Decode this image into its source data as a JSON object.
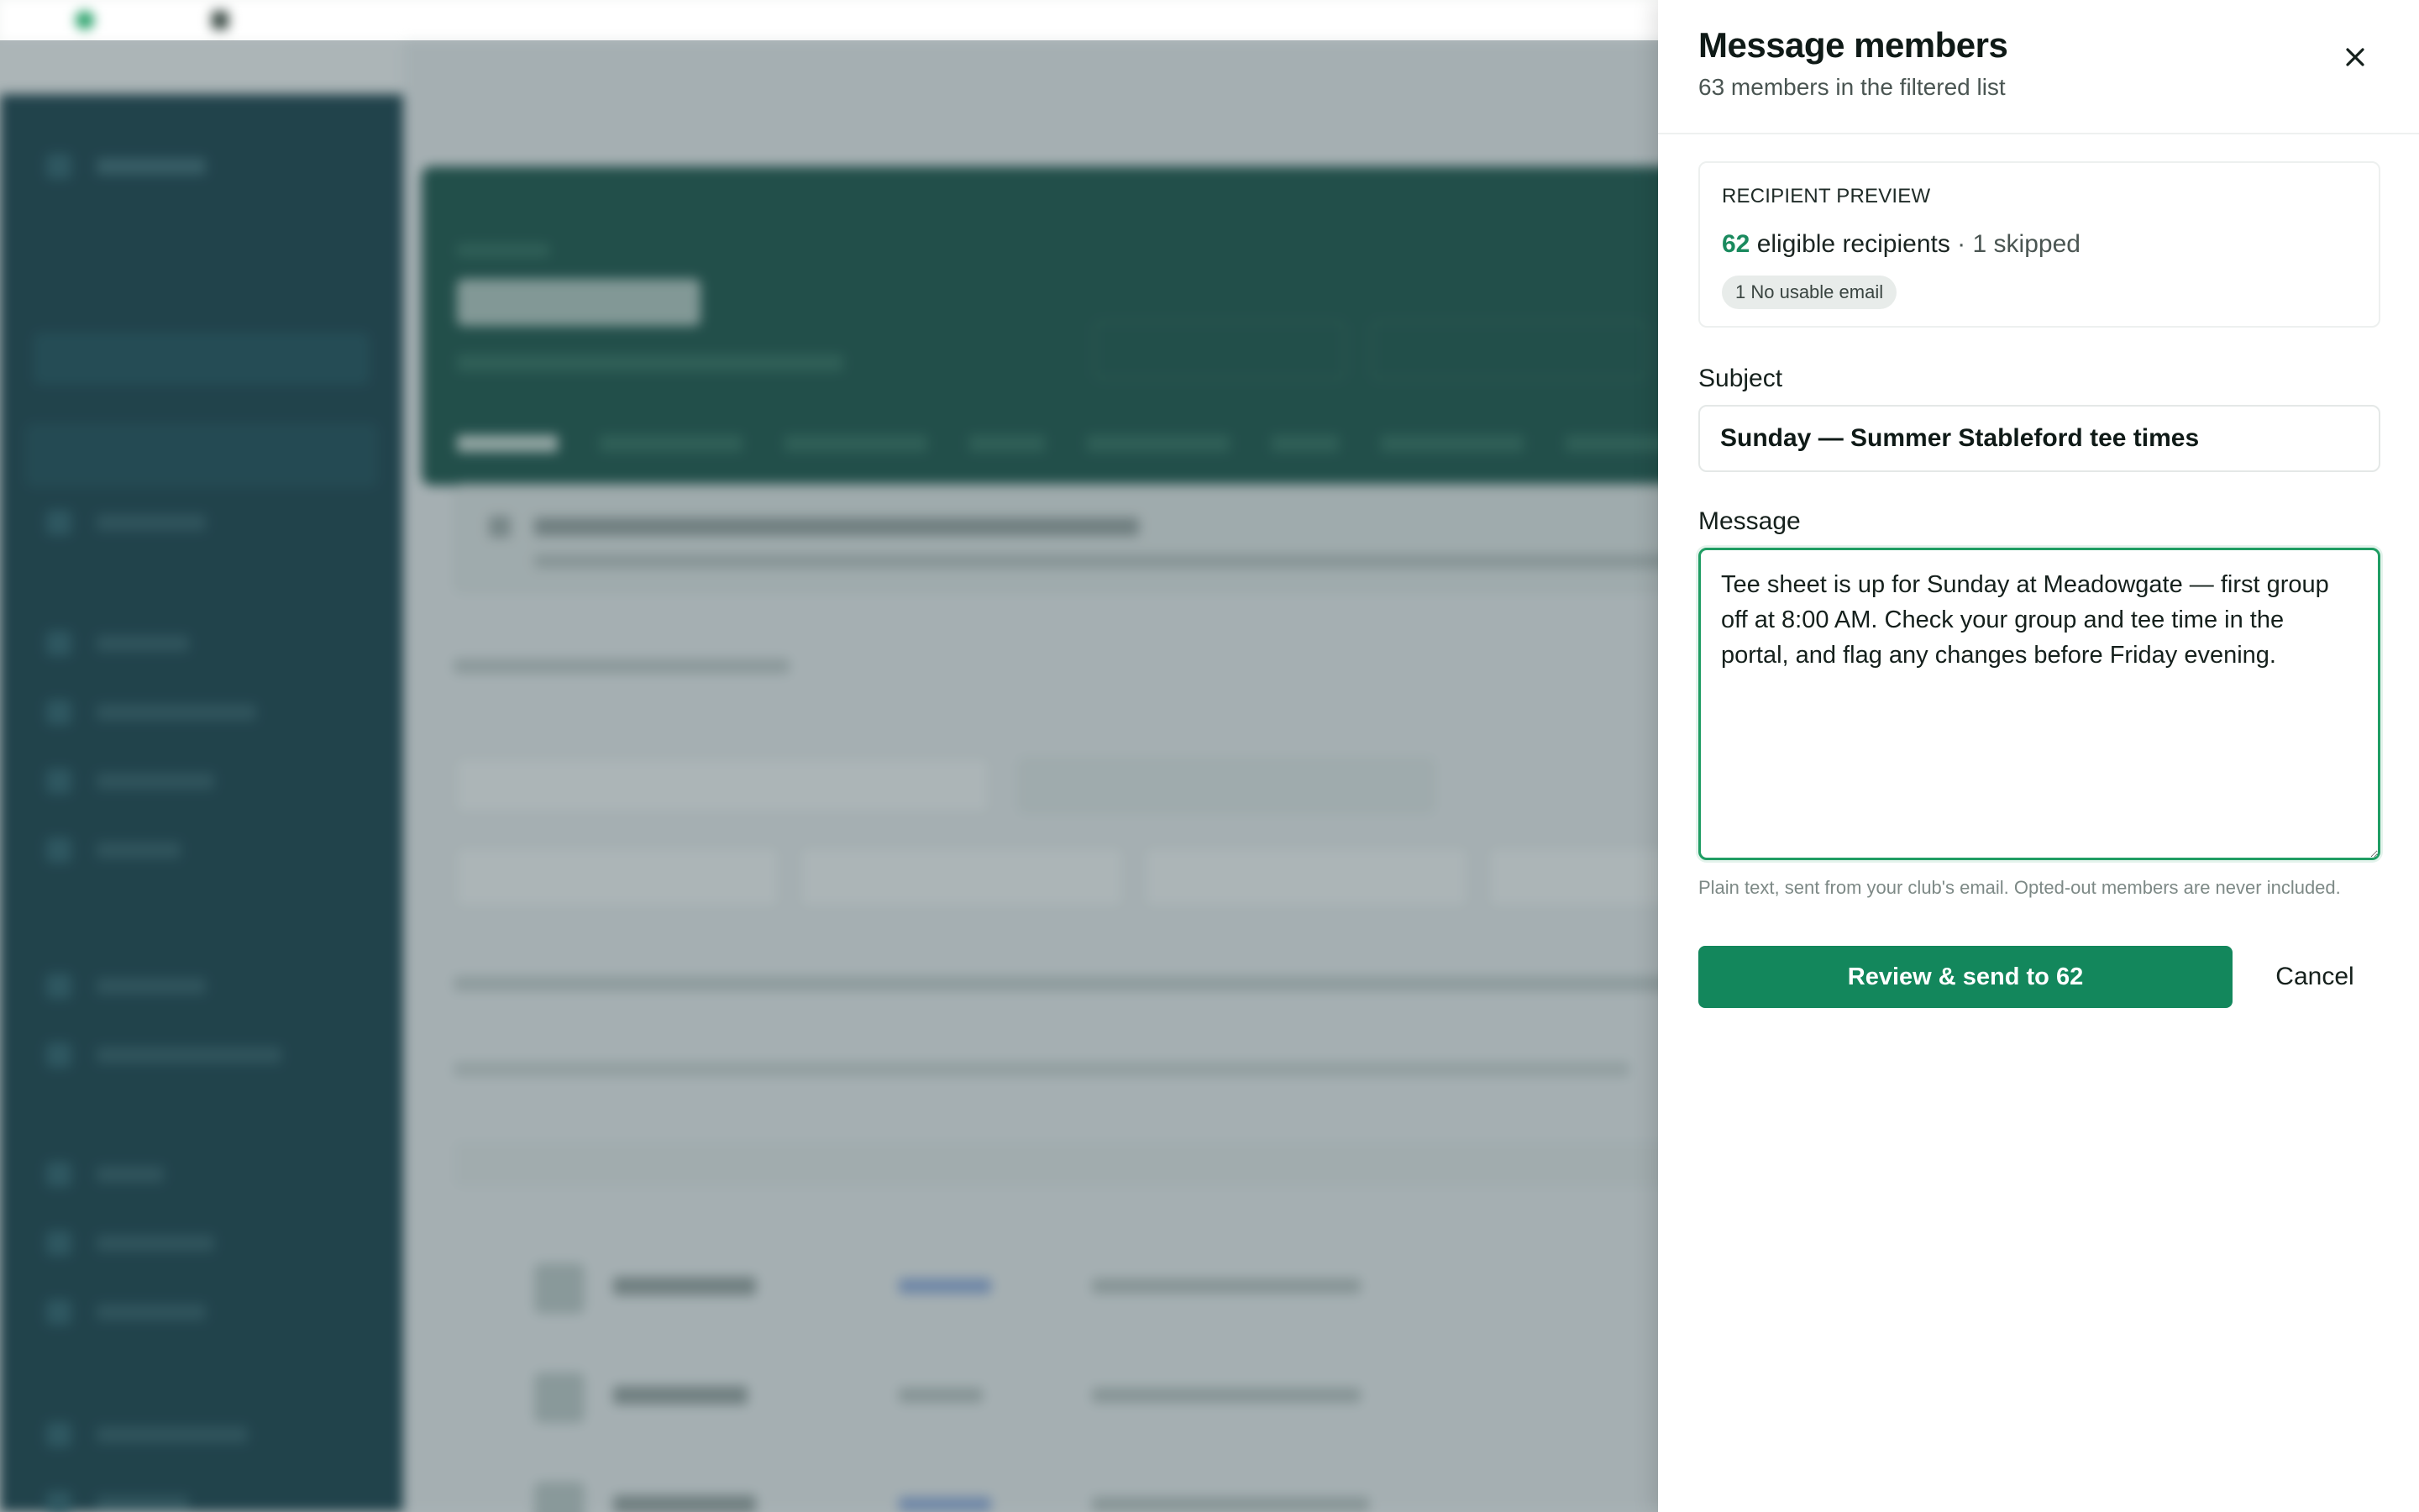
{
  "drawer": {
    "title": "Message members",
    "subtitle": "63 members in the filtered list",
    "close_icon": "close-icon",
    "preview": {
      "kicker": "RECIPIENT PREVIEW",
      "eligible_count": "62",
      "eligible_label": " eligible recipients",
      "separator": " · ",
      "skipped": "1 skipped",
      "chip": "1 No usable email"
    },
    "subject": {
      "label": "Subject",
      "value": "Sunday — Summer Stableford tee times"
    },
    "message": {
      "label": "Message",
      "value": "Tee sheet is up for Sunday at Meadowgate — first group off at 8:00 AM. Check your group and tee time in the portal, and flag any changes before Friday evening.",
      "hint": "Plain text, sent from your club's email. Opted-out members are never included."
    },
    "actions": {
      "primary": "Review & send to 62",
      "cancel": "Cancel"
    }
  },
  "colors": {
    "accent": "#13875c",
    "accent_text": "#1a8a5e",
    "sidebar": "#06323c",
    "hero": "#08473a"
  }
}
